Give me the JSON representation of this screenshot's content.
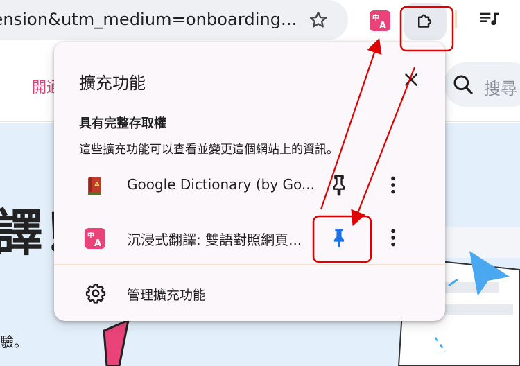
{
  "omnibox": {
    "url_text": "tension&utm_medium=onboarding...",
    "bookmark_icon": "star-outline-icon"
  },
  "toolbar": {
    "extension_icon": "translate-zh-a-icon",
    "extensions_button_icon": "puzzle-piece-icon",
    "media_icon": "queue-music-icon"
  },
  "page": {
    "header_link": "開通",
    "search_label": "搜尋",
    "hero_big_text": "譯！",
    "hero_small_text": "驗。"
  },
  "popup": {
    "title": "擴充功能",
    "close_icon": "close-icon",
    "section_title": "具有完整存取權",
    "section_desc": "這些擴充功能可以查看並變更這個網站上的資訊。",
    "extensions": [
      {
        "name": "Google Dictionary (by Go...",
        "icon": "dictionary-book-icon",
        "pinned": false
      },
      {
        "name": "沉浸式翻譯: 雙語對照網頁...",
        "icon": "translate-zh-a-icon",
        "pinned": true
      }
    ],
    "manage_label": "管理擴充功能",
    "manage_icon": "gear-icon"
  },
  "colors": {
    "accent_blue": "#1a73e8",
    "annotation_red": "#e00000",
    "brand_pink": "#e9437a"
  }
}
